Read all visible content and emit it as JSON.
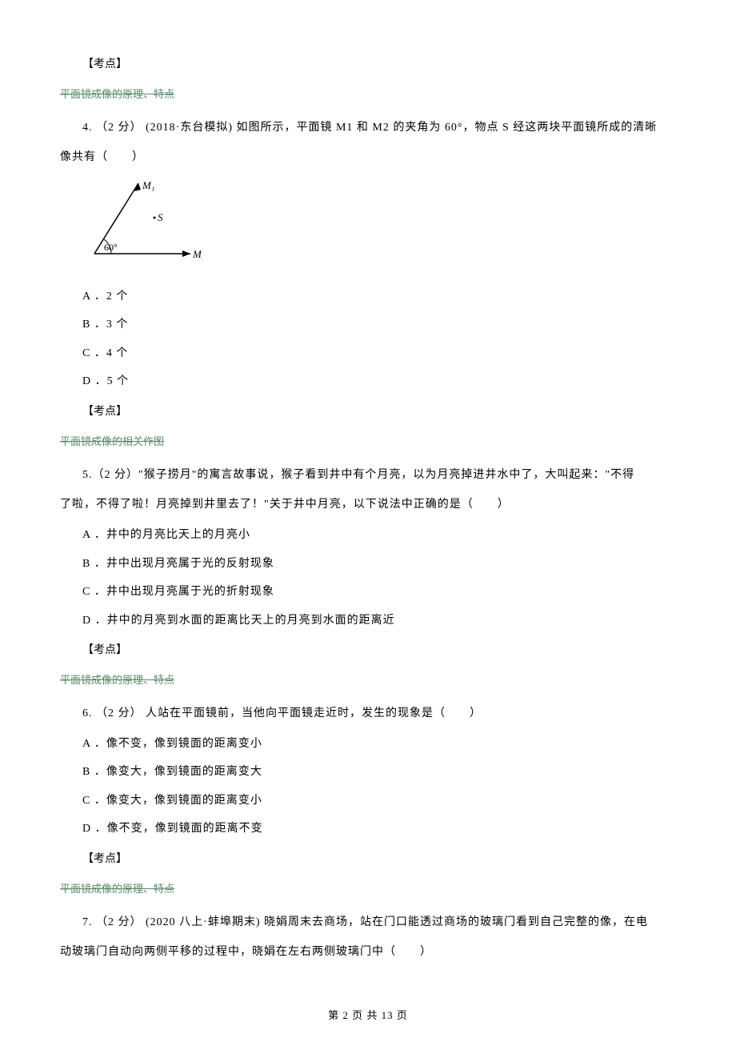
{
  "section_label": "【考点】",
  "topics": {
    "principle": "平面镜成像的原理、特点",
    "drawing": "平面镜成像的相关作图"
  },
  "q4": {
    "text": "4. （2 分） (2018·东台模拟) 如图所示，平面镜 M1 和 M2 的夹角为 60°，物点 S 经这两块平面镜所成的清晰",
    "text2": "像共有（　　）",
    "options": {
      "a": "A ．2 个",
      "b": "B ．3 个",
      "c": "C ．4 个",
      "d": "D ．5 个"
    },
    "diagram": {
      "m1_label": "M₁",
      "m2_label": "M₂",
      "angle": "60°",
      "point": "S"
    }
  },
  "q5": {
    "text": "5.（2 分）\"猴子捞月\"的寓言故事说，猴子看到井中有个月亮，以为月亮掉进井水中了，大叫起来：\"不得",
    "text2": "了啦，不得了啦！月亮掉到井里去了！\"关于井中月亮，以下说法中正确的是（　　）",
    "options": {
      "a": "A ．井中的月亮比天上的月亮小",
      "b": "B ．井中出现月亮属于光的反射现象",
      "c": "C ．井中出现月亮属于光的折射现象",
      "d": "D ．井中的月亮到水面的距离比天上的月亮到水面的距离近"
    }
  },
  "q6": {
    "text": "6. （2 分） 人站在平面镜前，当他向平面镜走近时，发生的现象是（　　）",
    "options": {
      "a": "A ．像不变，像到镜面的距离变小",
      "b": "B ．像变大，像到镜面的距离变大",
      "c": "C ．像变大，像到镜面的距离变小",
      "d": "D ．像不变，像到镜面的距离不变"
    }
  },
  "q7": {
    "text": "7. （2 分） (2020 八上·蚌埠期末) 晓娟周末去商场，站在门口能透过商场的玻璃门看到自己完整的像，在电",
    "text2": "动玻璃门自动向两侧平移的过程中，晓娟在左右两侧玻璃门中（　　）"
  },
  "footer": "第 2 页 共 13 页"
}
